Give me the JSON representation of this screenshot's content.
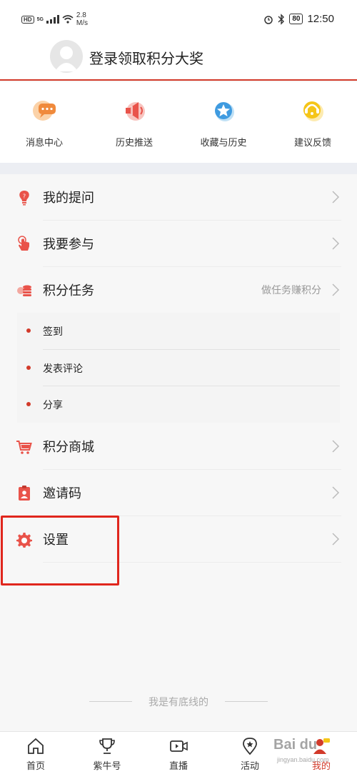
{
  "status_bar": {
    "hd": "HD",
    "net": "5G",
    "speed_value": "2.8",
    "speed_unit": "M/s",
    "battery": "80",
    "time": "12:50"
  },
  "profile": {
    "login_text": "登录领取积分大奖"
  },
  "quick_actions": [
    {
      "label": "消息中心",
      "icon": "message-icon",
      "color": "#f39a4a"
    },
    {
      "label": "历史推送",
      "icon": "megaphone-icon",
      "color": "#e9534a"
    },
    {
      "label": "收藏与历史",
      "icon": "star-icon",
      "color": "#3f9be0"
    },
    {
      "label": "建议反馈",
      "icon": "feedback-icon",
      "color": "#f5c518"
    }
  ],
  "menu": {
    "question": {
      "label": "我的提问",
      "icon": "question-bulb-icon"
    },
    "participate": {
      "label": "我要参与",
      "icon": "hand-pointer-icon"
    },
    "tasks": {
      "label": "积分任务",
      "hint": "做任务赚积分",
      "icon": "coins-icon"
    },
    "task_items": [
      "签到",
      "发表评论",
      "分享"
    ],
    "mall": {
      "label": "积分商城",
      "icon": "cart-icon"
    },
    "invite": {
      "label": "邀请码",
      "icon": "id-badge-icon"
    },
    "settings": {
      "label": "设置",
      "icon": "gear-icon"
    }
  },
  "bottom_text": "我是有底线的",
  "tabs": [
    {
      "label": "首页",
      "icon": "home-icon"
    },
    {
      "label": "紫牛号",
      "icon": "trophy-icon"
    },
    {
      "label": "直播",
      "icon": "video-icon"
    },
    {
      "label": "活动",
      "icon": "location-icon"
    },
    {
      "label": "我的",
      "icon": "user-icon",
      "active": true
    }
  ],
  "watermark": {
    "main": "Bai du",
    "sub": "jingyan.baidu.com"
  },
  "colors": {
    "accent": "#d23a2a",
    "highlight_box": "#e0261d"
  }
}
